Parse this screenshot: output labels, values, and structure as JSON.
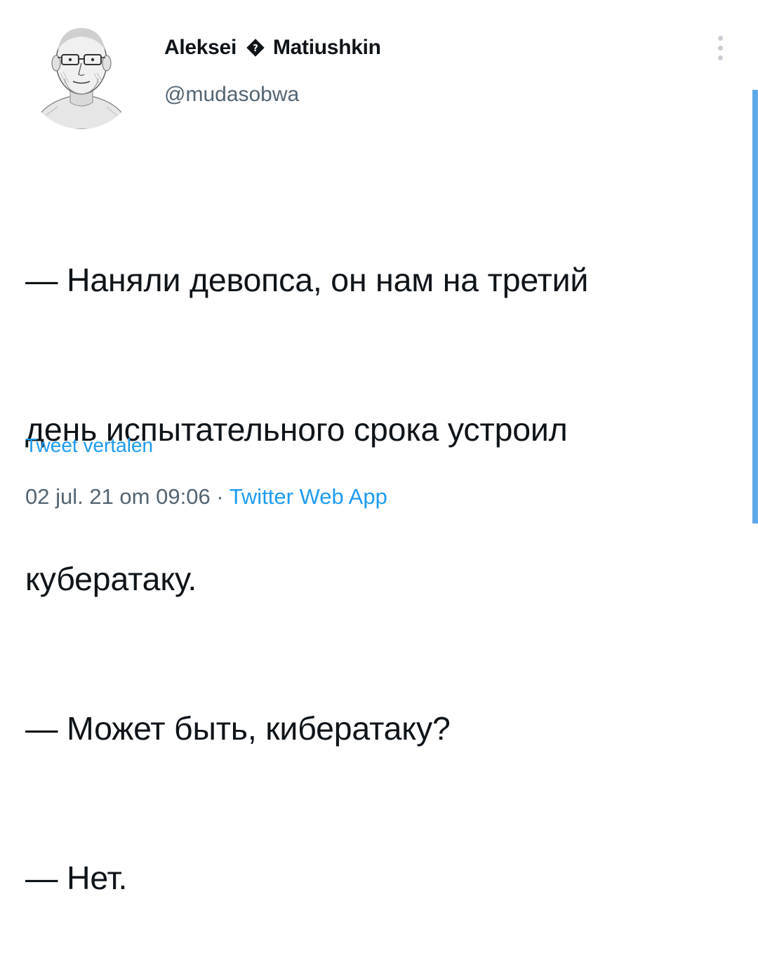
{
  "author": {
    "name_first": "Aleksei",
    "name_last": "Matiushkin",
    "name_separator_icon": "diamond-icon",
    "handle": "@mudasobwa"
  },
  "tweet": {
    "lines": [
      "— Наняли девопса, он нам на третий",
      "день испытательного срока устроил",
      "кубератаку.",
      "— Может быть, кибератаку?",
      "— Нет."
    ],
    "translate_label": "Tweet vertalen",
    "timestamp": "02 jul. 21 om 09:06",
    "separator": " · ",
    "source": "Twitter Web App"
  },
  "colors": {
    "text": "#0f1419",
    "secondary": "#536471",
    "link": "#1d9bf0",
    "scrollbar": "#5da9e8"
  }
}
